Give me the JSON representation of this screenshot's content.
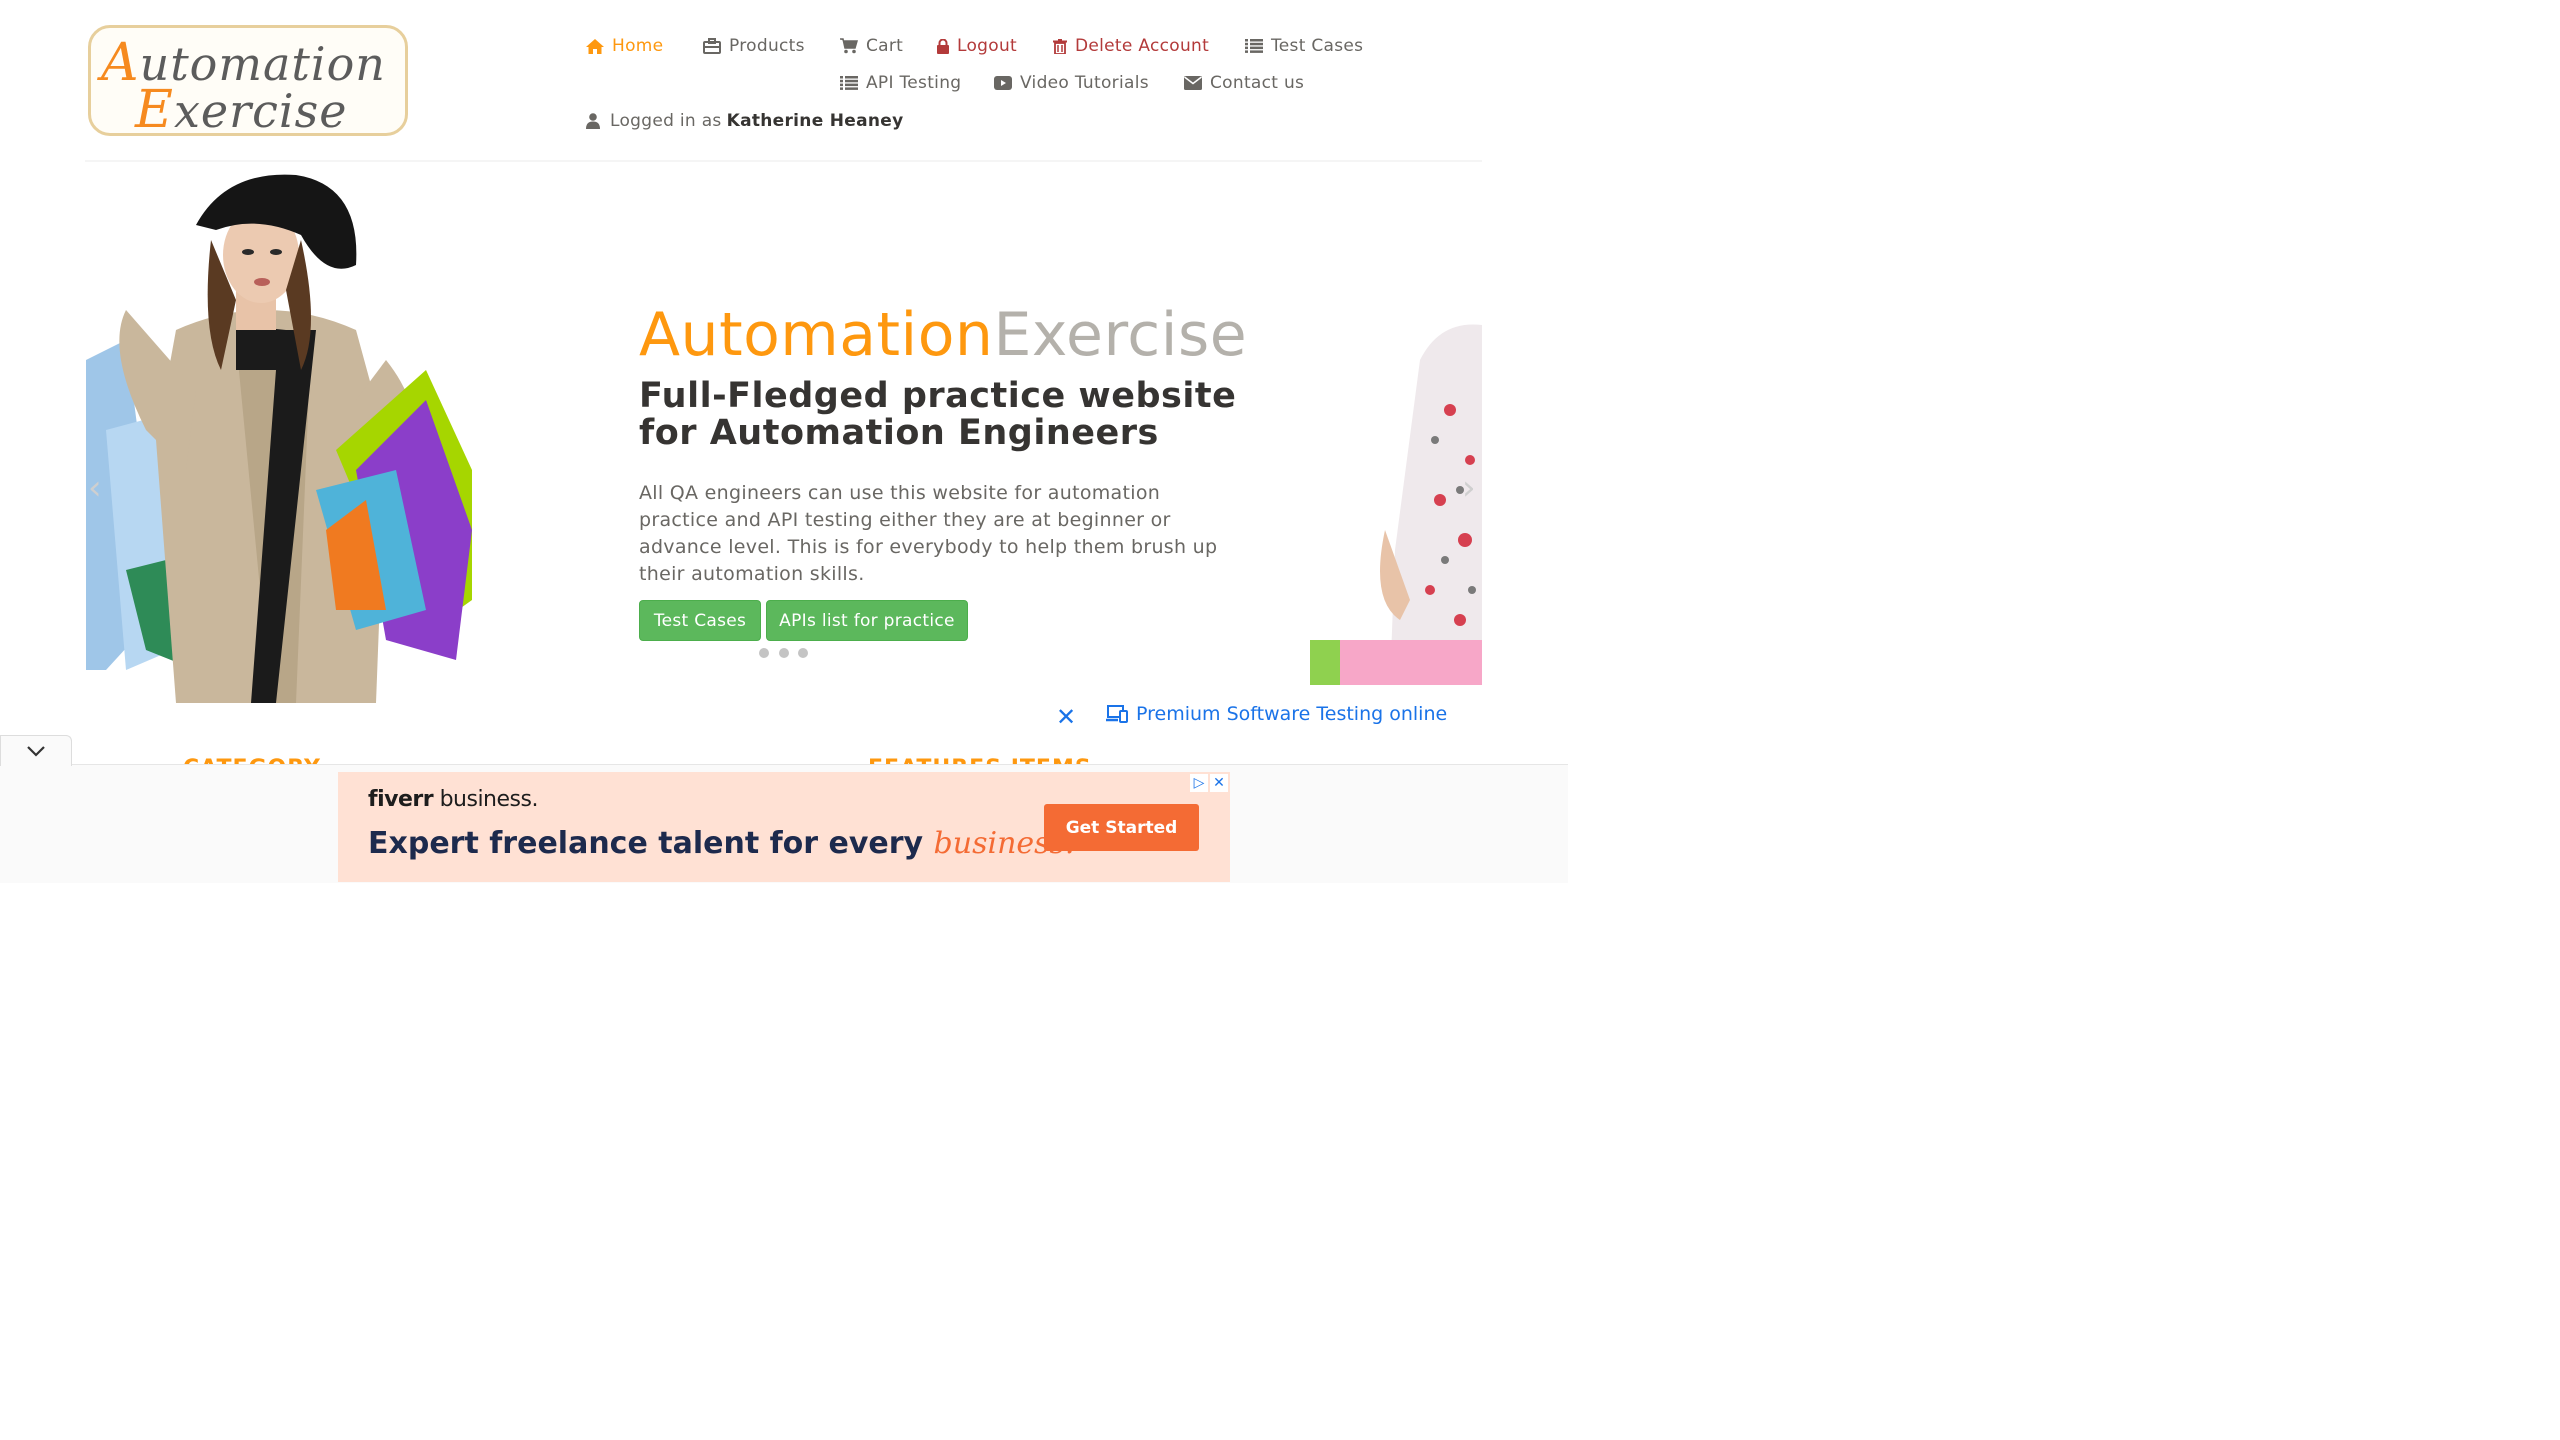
{
  "logo": {
    "line1_cap": "A",
    "line1_rest": "utomation",
    "line2_cap": "E",
    "line2_rest": "xercise"
  },
  "nav": {
    "home": "Home",
    "products": "Products",
    "cart": "Cart",
    "logout": "Logout",
    "delete_account": "Delete Account",
    "test_cases": "Test Cases",
    "api_testing": "API Testing",
    "video_tutorials": "Video Tutorials",
    "contact_us": "Contact us",
    "logged_prefix": "Logged in as",
    "username": "Katherine Heaney"
  },
  "hero": {
    "title_a": "Automation",
    "title_b": "Exercise",
    "subtitle": "Full-Fledged practice website for Automation Engineers",
    "description": "All QA engineers can use this website for automation practice and API testing either they are at beginner or advance level. This is for everybody to help them brush up their automation skills.",
    "button_test_cases": "Test Cases",
    "button_apis": "APIs list for practice",
    "prev": "‹",
    "next": "›"
  },
  "premium": {
    "close": "✕",
    "link": "Premium Software Testing online"
  },
  "sections": {
    "category": "CATEGORY",
    "features": "FEATURES ITEMS"
  },
  "ad": {
    "brand_a": "fiverr",
    "brand_b": " business.",
    "headline": "Expert freelance talent for every ",
    "headline_em": "business.",
    "cta": "Get Started"
  },
  "colors": {
    "accent": "#fe980f",
    "button": "#5cb85c",
    "link": "#1a73e8",
    "danger": "#b33a3a"
  }
}
